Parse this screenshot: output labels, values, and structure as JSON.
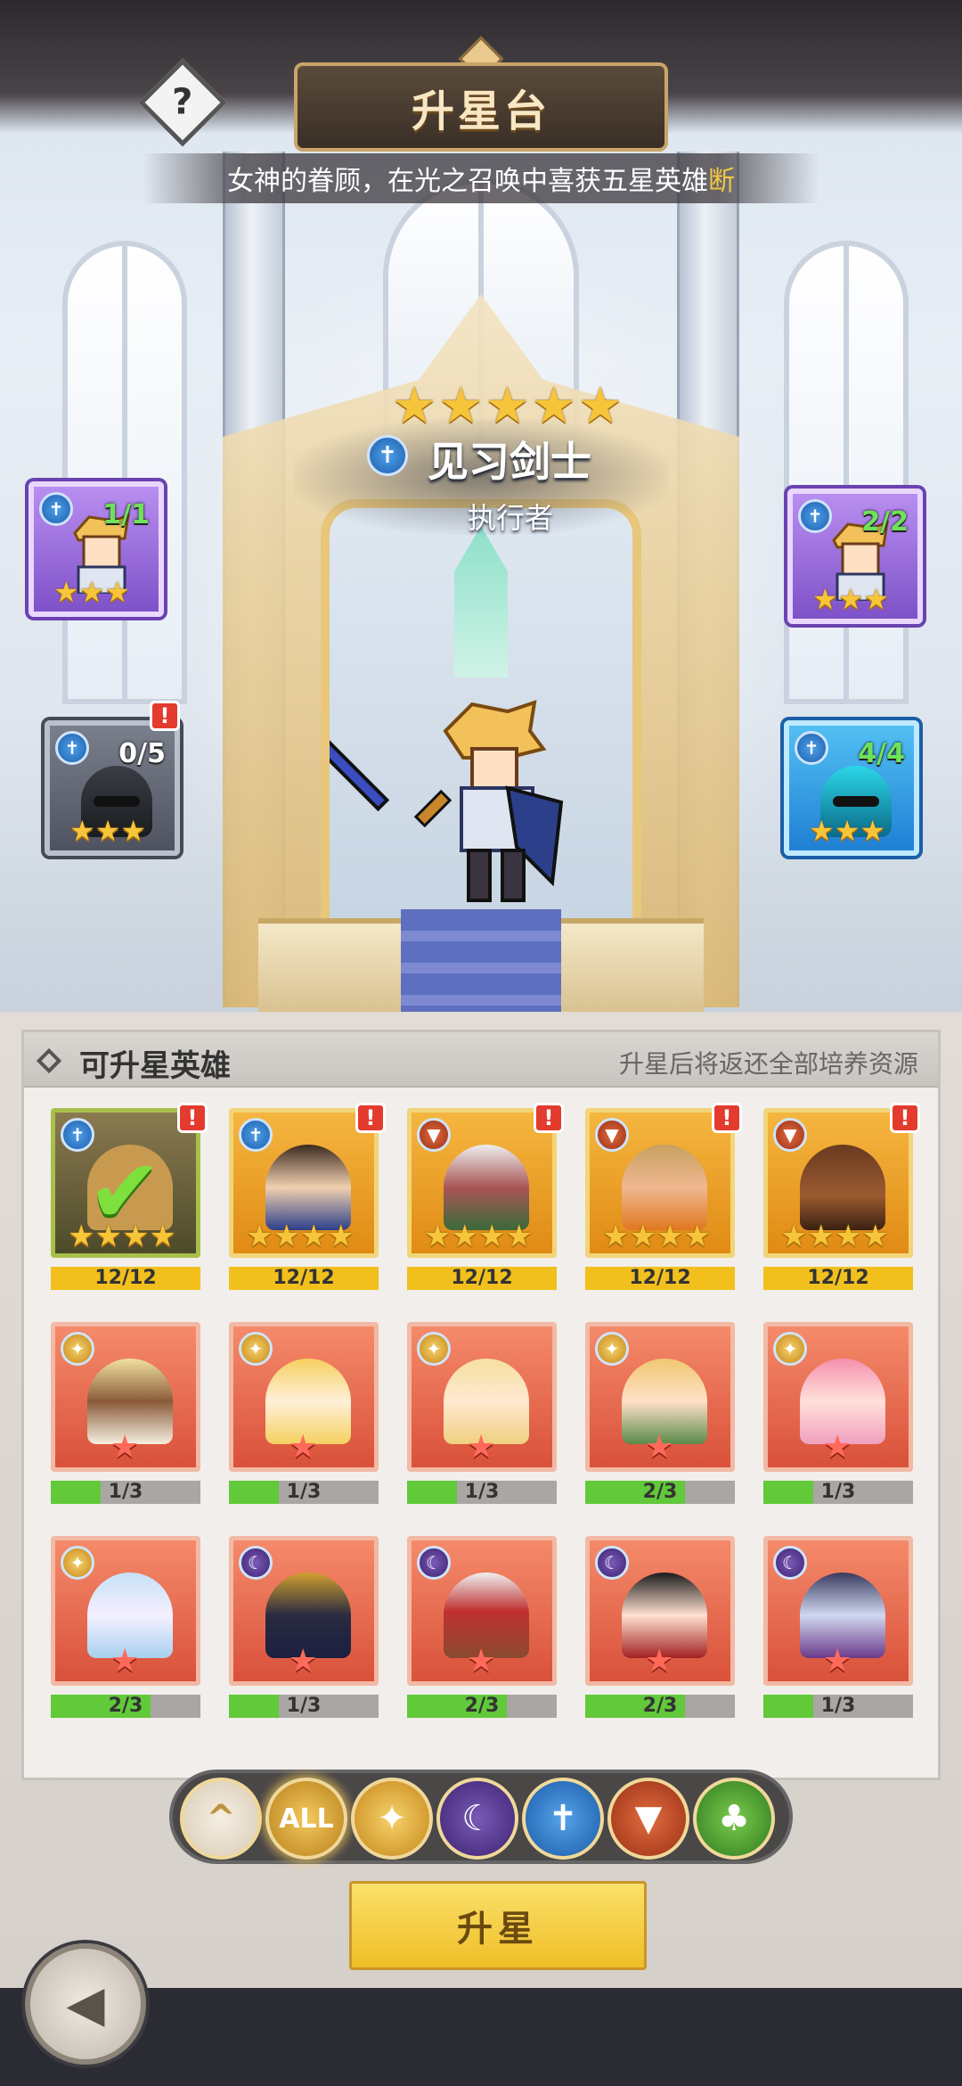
{
  "header": {
    "title": "升星台",
    "help_label": "?",
    "marquee": "女神的眷顾，在光之召唤中喜获五星英雄",
    "marquee_tail": "断"
  },
  "hero": {
    "stars": 5,
    "class_icon": "guardian-class-icon",
    "name": "见习剑士",
    "role": "执行者"
  },
  "materials": {
    "top_left": {
      "count": "1/1",
      "stars": 3
    },
    "top_right": {
      "count": "2/2",
      "stars": 3
    },
    "bottom_left": {
      "count": "0/5",
      "stars": 3,
      "alert": "!"
    },
    "bottom_right": {
      "count": "4/4",
      "stars": 3
    }
  },
  "list": {
    "title": "可升星英雄",
    "note": "升星后将返还全部培养资源",
    "rows": [
      [
        {
          "progress": "12/12",
          "fraction": 1.0,
          "alert": "!",
          "selected": true
        },
        {
          "progress": "12/12",
          "fraction": 1.0,
          "alert": "!"
        },
        {
          "progress": "12/12",
          "fraction": 1.0,
          "alert": "!"
        },
        {
          "progress": "12/12",
          "fraction": 1.0,
          "alert": "!"
        },
        {
          "progress": "12/12",
          "fraction": 1.0,
          "alert": "!"
        }
      ],
      [
        {
          "progress": "1/3",
          "fraction": 0.333
        },
        {
          "progress": "1/3",
          "fraction": 0.333
        },
        {
          "progress": "1/3",
          "fraction": 0.333
        },
        {
          "progress": "2/3",
          "fraction": 0.667
        },
        {
          "progress": "1/3",
          "fraction": 0.333
        }
      ],
      [
        {
          "progress": "2/3",
          "fraction": 0.667
        },
        {
          "progress": "1/3",
          "fraction": 0.333
        },
        {
          "progress": "2/3",
          "fraction": 0.667
        },
        {
          "progress": "2/3",
          "fraction": 0.667
        },
        {
          "progress": "1/3",
          "fraction": 0.333
        }
      ]
    ]
  },
  "filters": {
    "collapse_icon": "^",
    "all_label": "ALL",
    "holy_icon": "✦",
    "dark_icon": "☾",
    "guard_icon": "✝",
    "beast_icon": "▼",
    "nature_icon": "♣"
  },
  "actions": {
    "upstar_label": "升星",
    "back_icon": "◀"
  },
  "colors": {
    "star": "#f6c53a",
    "progress_full": "#f2c01c",
    "progress_partial": "#61c93a",
    "alert": "#e33b2e"
  }
}
